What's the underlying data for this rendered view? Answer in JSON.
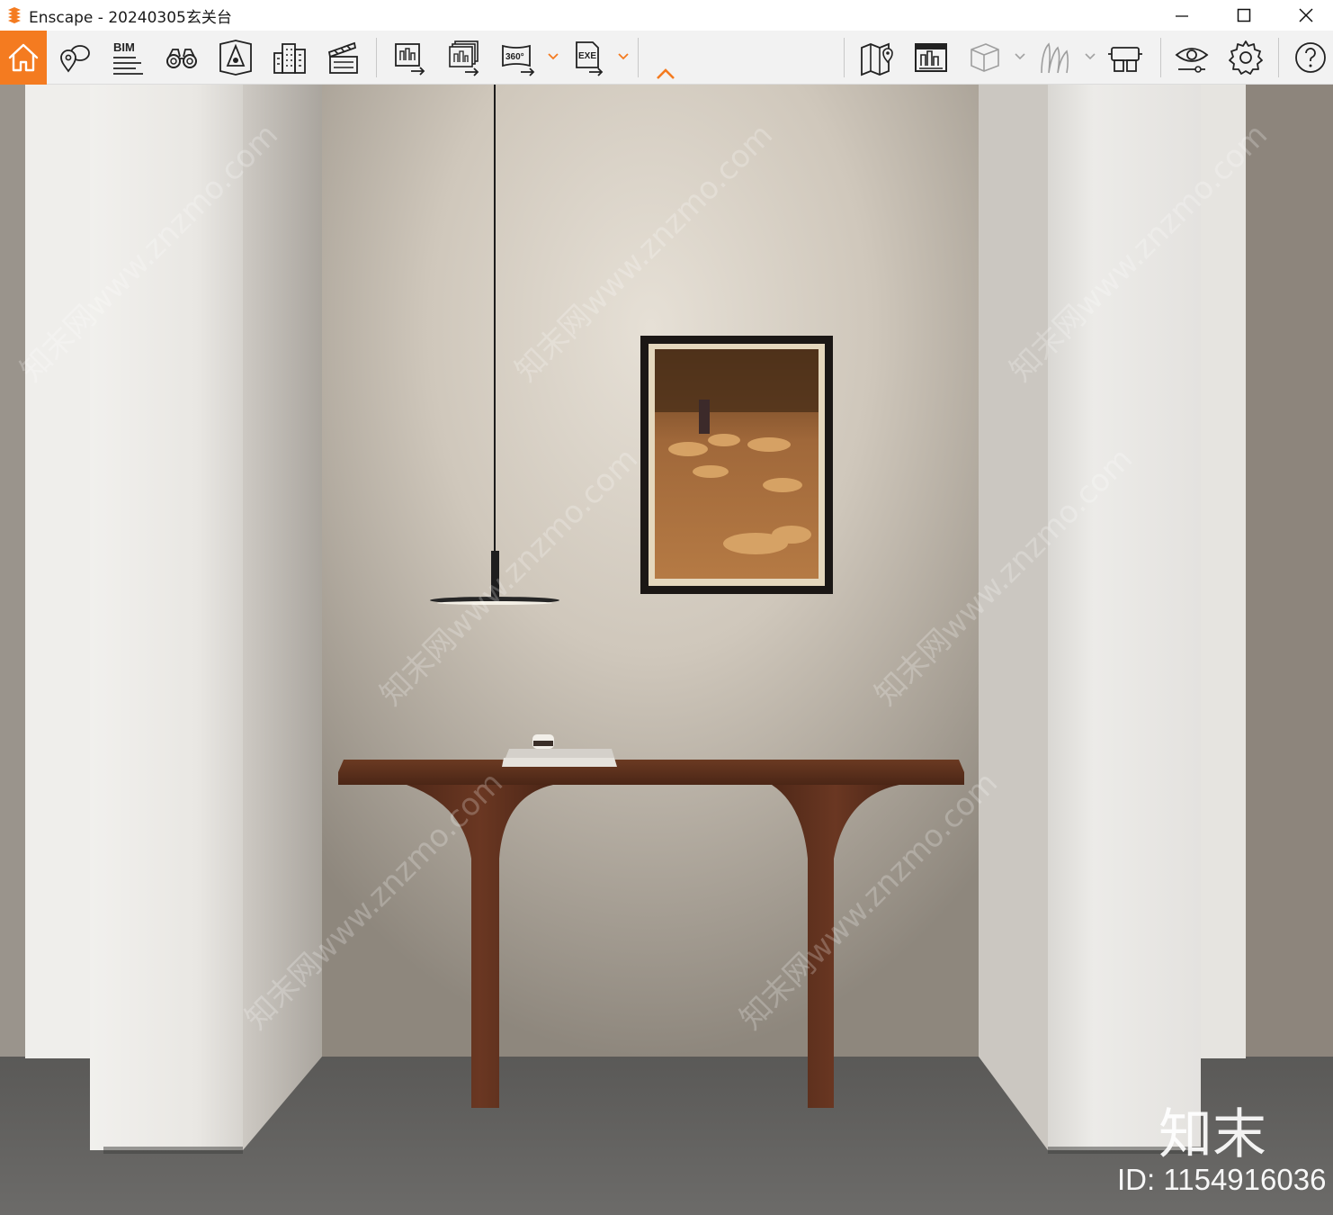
{
  "window": {
    "title": "Enscape - 20240305玄关台",
    "controls": [
      "minimize",
      "maximize",
      "close"
    ]
  },
  "toolbar": {
    "bim_label": "BIM",
    "panorama_label": "360°",
    "exe_label": "EXE",
    "accent_color": "#f47b20",
    "groups": [
      [
        "home-icon",
        "location-pin-icon",
        "bim-icon",
        "binoculars-icon",
        "perspective-icon",
        "buildings-icon",
        "clapperboard-icon"
      ],
      [
        "screenshot-export-icon",
        "batch-render-icon",
        "panorama-360-icon",
        "exe-export-icon"
      ],
      [
        "map-icon",
        "asset-library-icon",
        "cube-icon",
        "grass-icon",
        "vr-headset-icon"
      ],
      [
        "eye-view-icon",
        "gear-icon"
      ],
      [
        "help-icon"
      ]
    ]
  },
  "watermark": {
    "site": "知末网www.znzmo.com",
    "brand": "知末",
    "id_text": "ID: 1154916036"
  }
}
